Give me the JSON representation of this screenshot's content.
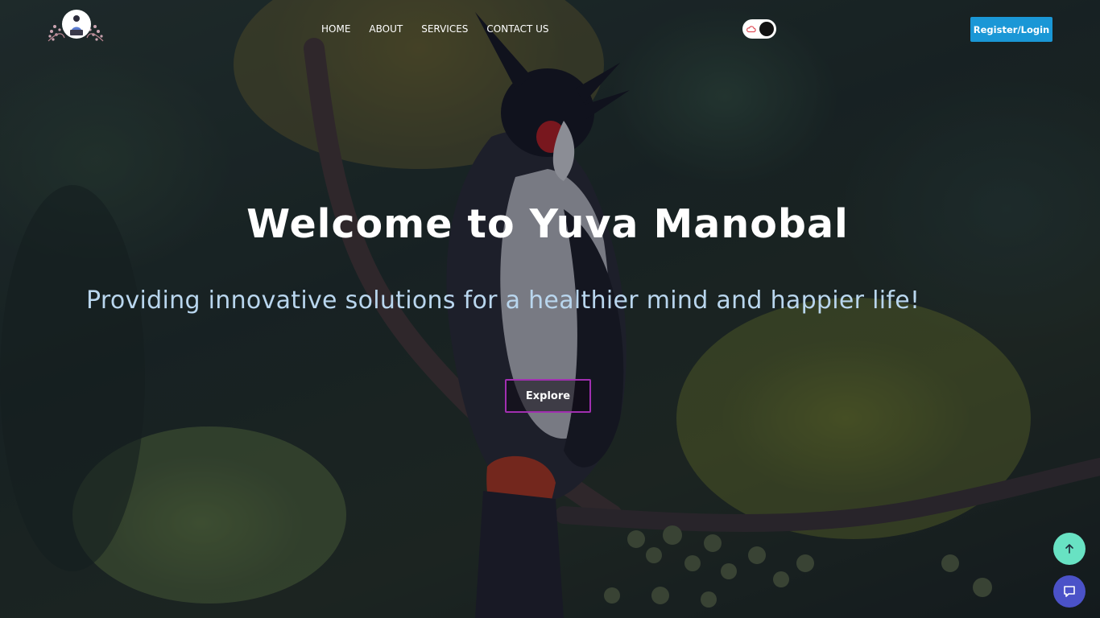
{
  "nav": {
    "links": [
      {
        "label": "HOME"
      },
      {
        "label": "ABOUT"
      },
      {
        "label": "SERVICES"
      },
      {
        "label": "CONTACT US"
      }
    ],
    "register_label": "Register/Login",
    "theme_toggle_state": "dark"
  },
  "hero": {
    "title": "Welcome to Yuva Manobal",
    "subtitle": "Providing innovative solutions for a healthier mind and happier life!",
    "explore_label": "Explore"
  },
  "icons": {
    "logo": "person-with-laptop-logo",
    "toggle": "cloud-icon",
    "scroll_top": "arrow-up-icon",
    "chat": "chat-bubble-icon"
  },
  "colors": {
    "register_button": "#1a97d6",
    "explore_border": "#a12fb0",
    "scroll_top_button": "#68e2c3",
    "chat_button": "#4b52c8",
    "subtitle": "#b9d6ee"
  }
}
